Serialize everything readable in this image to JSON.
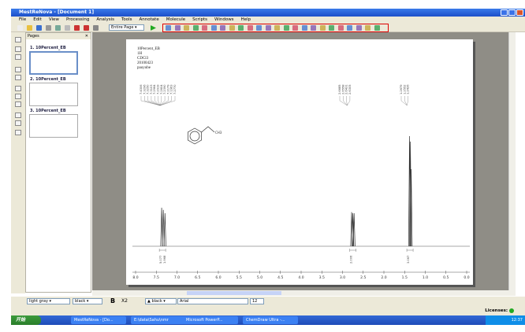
{
  "window": {
    "title": "MestReNova - [Document 1]"
  },
  "menu": [
    "File",
    "Edit",
    "View",
    "Processing",
    "Analysis",
    "Tools",
    "Annotate",
    "Molecule",
    "Scripts",
    "Windows",
    "Help"
  ],
  "toolbar": {
    "zoom_select": "Entire Page"
  },
  "pages_panel": {
    "title": "Pages",
    "items": [
      {
        "label": "1. 10Percent_EB"
      },
      {
        "label": "2. 10Percent_EB"
      },
      {
        "label": "3. 10Percent_EB"
      }
    ]
  },
  "spectrum": {
    "meta": [
      "10Percent_EB",
      "1H",
      "CDCl3",
      "20100423",
      "pauyube"
    ],
    "molecule_label": "CH3",
    "peak_labels": {
      "aromatic": [
        "7.4306",
        "7.3296",
        "7.3250",
        "7.3103",
        "7.2964",
        "7.2919",
        "7.2604",
        "7.2390",
        "7.2179",
        "7.1963",
        "7.2770"
      ],
      "ch2": [
        "2.6685",
        "2.6558",
        "2.6431",
        "2.6305"
      ],
      "ch3": [
        "1.2679",
        "1.2552",
        "1.2426"
      ]
    },
    "integrals": [
      {
        "ppm": 7.35,
        "labels": [
          "5.077",
          "1.968"
        ]
      },
      {
        "ppm": 2.75,
        "label": "2.006"
      },
      {
        "ppm": 1.37,
        "label": "3.067"
      }
    ],
    "peaks": [
      {
        "ppm": 7.37,
        "height": 0.35
      },
      {
        "ppm": 7.33,
        "height": 0.33
      },
      {
        "ppm": 7.29,
        "height": 0.3
      },
      {
        "ppm": 2.78,
        "height": 0.31
      },
      {
        "ppm": 2.75,
        "height": 0.3
      },
      {
        "ppm": 2.72,
        "height": 0.3
      },
      {
        "ppm": 1.38,
        "height": 1.0
      },
      {
        "ppm": 1.36,
        "height": 0.95
      },
      {
        "ppm": 1.34,
        "height": 0.7
      }
    ],
    "xaxis": {
      "min": 0,
      "max": 8,
      "ticks": [
        "8.0",
        "7.5",
        "7.0",
        "6.5",
        "6.0",
        "5.5",
        "5.0",
        "4.5",
        "4.0",
        "3.5",
        "3.0",
        "2.5",
        "2.0",
        "1.5",
        "1.0",
        "0.5",
        "0.0"
      ]
    }
  },
  "format_bar": {
    "fill": "light gray",
    "line": "black",
    "bold": "B",
    "subscript": "X2",
    "font_color": "black",
    "font": "Arial",
    "size": "12"
  },
  "status": {
    "licenses": "Licenses:"
  },
  "taskbar": {
    "start": "开始",
    "tasks": [
      "MestReNova - [Do...",
      "E:\\data\\Sahu\\nmr",
      "Microsoft PowerP...",
      "ChemDraw Ultra -..."
    ],
    "clock": "12:37"
  }
}
